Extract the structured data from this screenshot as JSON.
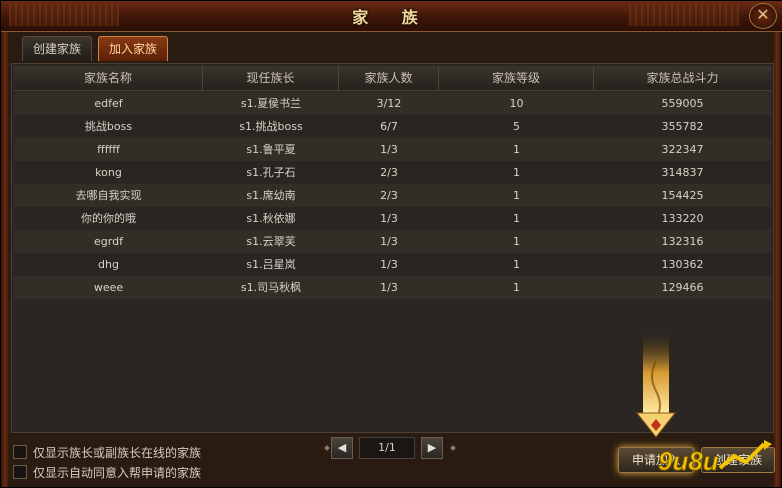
{
  "window": {
    "title": "家 族",
    "close_label": "✕"
  },
  "tabs": [
    {
      "label": "创建家族"
    },
    {
      "label": "加入家族"
    }
  ],
  "table": {
    "headers": [
      "家族名称",
      "现任族长",
      "家族人数",
      "家族等级",
      "家族总战斗力"
    ],
    "rows": [
      [
        "edfef",
        "s1.夏侯书兰",
        "3/12",
        "10",
        "559005"
      ],
      [
        "挑战boss",
        "s1.挑战boss",
        "6/7",
        "5",
        "355782"
      ],
      [
        "ffffff",
        "s1.鲁平夏",
        "1/3",
        "1",
        "322347"
      ],
      [
        "kong",
        "s1.孔子石",
        "2/3",
        "1",
        "314837"
      ],
      [
        "去哪自我实现",
        "s1.席幼南",
        "2/3",
        "1",
        "154425"
      ],
      [
        "你的你的哦",
        "s1.秋依娜",
        "1/3",
        "1",
        "133220"
      ],
      [
        "egrdf",
        "s1.云翠芙",
        "1/3",
        "1",
        "132316"
      ],
      [
        "dhg",
        "s1.吕星岚",
        "1/3",
        "1",
        "130362"
      ],
      [
        "weee",
        "s1.司马秋枫",
        "1/3",
        "1",
        "129466"
      ]
    ]
  },
  "filters": [
    {
      "label": "仅显示族长或副族长在线的家族"
    },
    {
      "label": "仅显示自动同意入帮申请的家族"
    }
  ],
  "pager": {
    "prev_icon": "◀",
    "next_icon": "▶",
    "page": "1/1"
  },
  "buttons": {
    "apply": "申请加入",
    "create": "创建家族"
  },
  "watermark": {
    "text": "9u8u"
  },
  "colors": {
    "accent": "#e0b040",
    "title": "#f3d9a0",
    "tab_active": "#8a3a14"
  }
}
